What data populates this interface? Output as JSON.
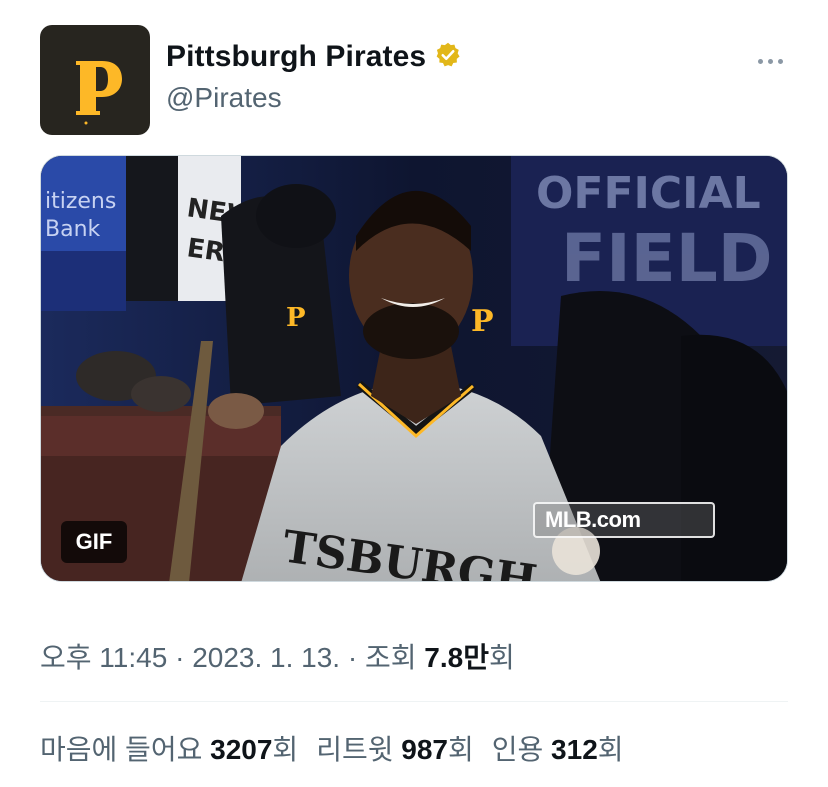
{
  "account": {
    "display_name": "Pittsburgh Pirates",
    "handle": "@Pirates",
    "avatar_icon": "pirates-p-logo",
    "verified_icon": "verified-gold-badge",
    "verified_color": "#e2b719"
  },
  "media": {
    "badge": "GIF",
    "watermark": "MLB.com",
    "banner_left": "Citizens Bank",
    "banner_mid": "NEW ERA",
    "banner_right": "OFFICIAL FIELD MLB"
  },
  "meta": {
    "time": "오후 11:45",
    "sep1": " · ",
    "date": "2023. 1. 13.",
    "sep2": " · ",
    "views_label": "조회 ",
    "views_value": "7.8만",
    "views_suffix": "회"
  },
  "stats": {
    "likes_label": "마음에 들어요 ",
    "likes_value": "3207",
    "likes_suffix": "회",
    "retweets_label": "리트윗 ",
    "retweets_value": "987",
    "retweets_suffix": "회",
    "quotes_label": "인용 ",
    "quotes_value": "312",
    "quotes_suffix": "회"
  },
  "colors": {
    "primary_text": "#0f1419",
    "secondary_text": "#536471",
    "pirates_black": "#27251f",
    "pirates_gold": "#fdb827"
  }
}
